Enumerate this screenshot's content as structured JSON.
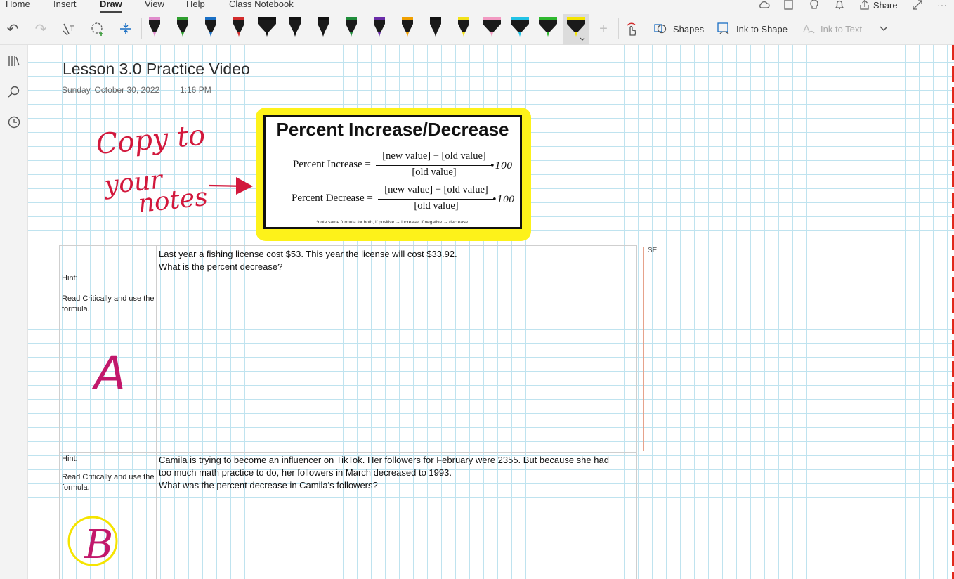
{
  "ribbon": {
    "tabs": [
      "Home",
      "Insert",
      "Draw",
      "View",
      "Help",
      "Class Notebook"
    ],
    "active_tab": "Draw",
    "share_label": "Share",
    "shapes_label": "Shapes",
    "ink_to_shape_label": "Ink to Shape",
    "ink_to_text_label": "Ink to Text",
    "pen_colors": [
      "#e08ccc",
      "#2e9e2e",
      "#1a6fc4",
      "#d22b2b",
      "#111111",
      "#111111",
      "#111111",
      "#1f8c3a",
      "#6a2ca8",
      "#f0a000",
      "#111111",
      "#f2e11a",
      "#f29ac2",
      "#22c3e6",
      "#2fb82f",
      "#f5e400"
    ],
    "selected_pen_color": "#f5e400"
  },
  "page": {
    "title": "Lesson 3.0 Practice Video",
    "date": "Sunday, October 30, 2022",
    "time": "1:16 PM"
  },
  "formula_card": {
    "title": "Percent Increase/Decrease",
    "increase_label": "Percent Increase =",
    "decrease_label": "Percent Decrease =",
    "numerator": "[new value] − [old value]",
    "denominator": "[old value]",
    "note": "*note same formula for both, if positive → increase, if negative → decrease."
  },
  "ink_annotations": {
    "copy_note_line1": "Copy to",
    "copy_note_line2": "your",
    "copy_note_line3": "notes",
    "times_100": "•100",
    "letter_a": "A",
    "letter_b": "B"
  },
  "side_label": "SE",
  "problems": [
    {
      "hint_title": "Hint:",
      "hint_text": "Read Critically and use the formula.",
      "question_line1": "Last year a fishing license cost $53. This year the license will cost $33.92.",
      "question_line2": "What is the percent decrease?"
    },
    {
      "hint_title": "Hint:",
      "hint_text": "Read Critically and use the formula.",
      "question_line1": "Camila is trying to become an influencer on TikTok.  Her followers for February were 2355. But because she had",
      "question_line2": "too much math practice to do, her followers in March decreased to 1993.",
      "question_line3": "What was the percent decrease in Camila's followers?"
    }
  ],
  "colors": {
    "ink_red": "#d2183c",
    "ink_magenta": "#c2186b",
    "highlighter_yellow": "#fdf21a",
    "grid_blue": "#bfe3ef",
    "margin_red": "#e0281b"
  }
}
